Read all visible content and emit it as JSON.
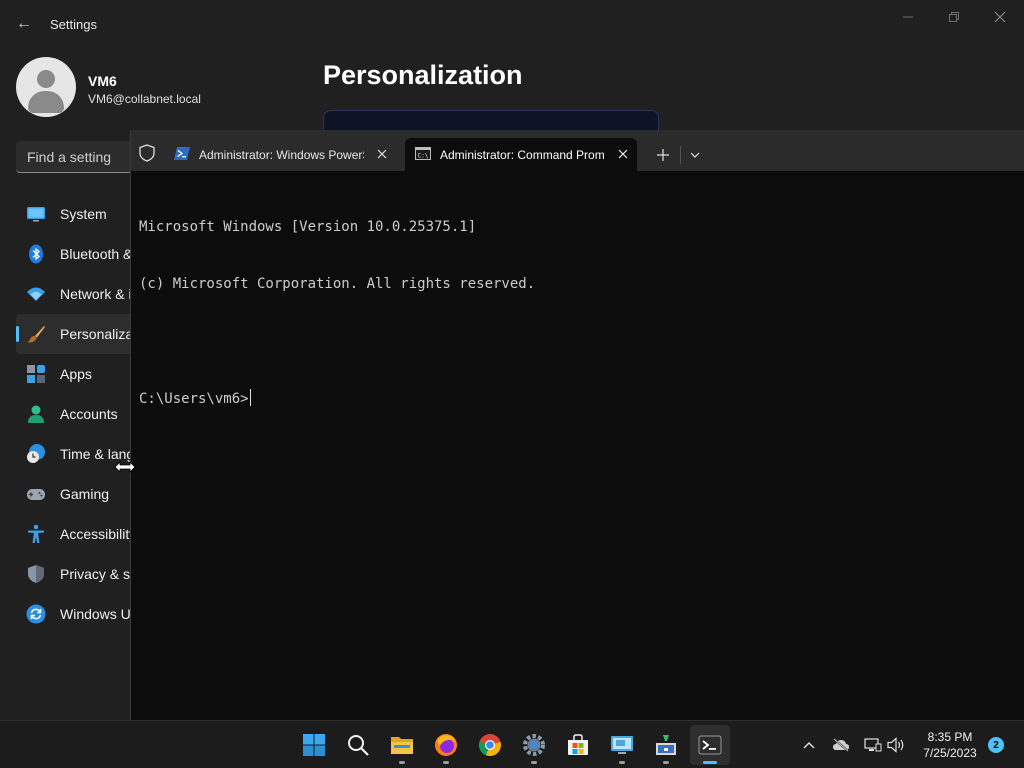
{
  "settings": {
    "app_title": "Settings",
    "user": {
      "name": "VM6",
      "email": "VM6@collabnet.local"
    },
    "search": {
      "placeholder": "Find a setting"
    },
    "page_title": "Personalization",
    "nav_items": [
      {
        "label": "System",
        "icon": "monitor-icon"
      },
      {
        "label": "Bluetooth & devices",
        "icon": "bluetooth-icon"
      },
      {
        "label": "Network & internet",
        "icon": "wifi-icon"
      },
      {
        "label": "Personalization",
        "icon": "paintbrush-icon",
        "active": true
      },
      {
        "label": "Apps",
        "icon": "apps-icon"
      },
      {
        "label": "Accounts",
        "icon": "person-icon"
      },
      {
        "label": "Time & language",
        "icon": "clock-globe-icon"
      },
      {
        "label": "Gaming",
        "icon": "gamepad-icon"
      },
      {
        "label": "Accessibility",
        "icon": "accessibility-icon"
      },
      {
        "label": "Privacy & security",
        "icon": "shield-icon"
      },
      {
        "label": "Windows Update",
        "icon": "sync-icon"
      }
    ]
  },
  "terminal": {
    "tabs": [
      {
        "label": "Administrator: Windows PowerShell",
        "icon": "powershell-icon",
        "active": false
      },
      {
        "label": "Administrator:  Command Prompt",
        "icon": "cmd-icon",
        "active": true
      }
    ],
    "console_lines": [
      "Microsoft Windows [Version 10.0.25375.1]",
      "(c) Microsoft Corporation. All rights reserved.",
      ""
    ],
    "prompt": "C:\\Users\\vm6>"
  },
  "taskbar": {
    "apps": [
      "windows-start-icon",
      "search-icon",
      "file-explorer-icon",
      "firefox-icon",
      "chrome-icon",
      "settings-icon",
      "store-icon",
      "remote-desktop-icon",
      "network-tool-icon",
      "terminal-icon"
    ],
    "clock": {
      "time": "8:35 PM",
      "date": "7/25/2023"
    },
    "notification_count": "2"
  }
}
